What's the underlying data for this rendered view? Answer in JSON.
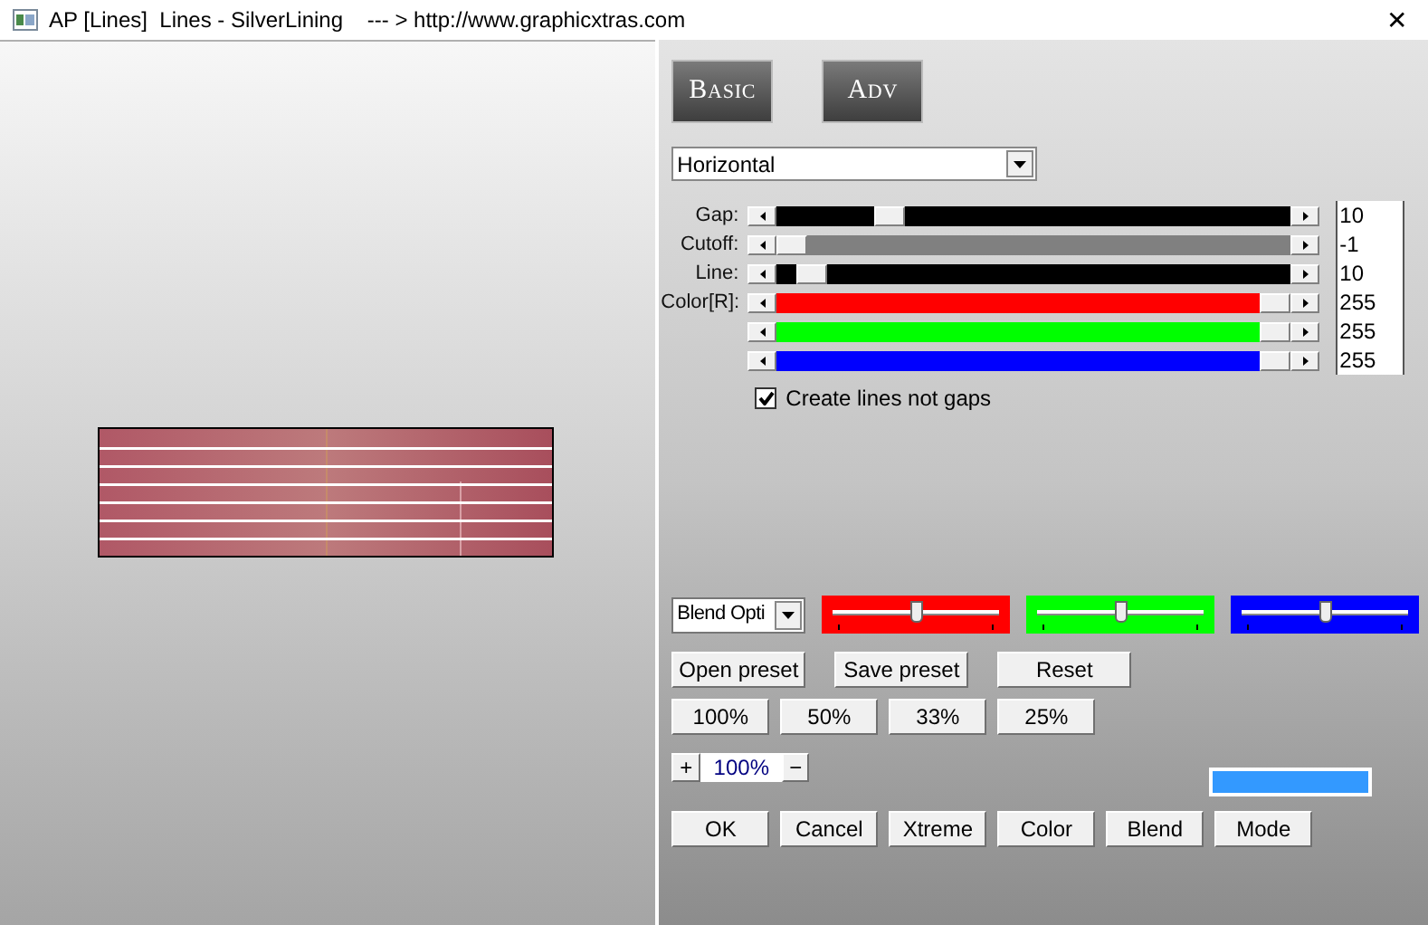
{
  "window": {
    "title": "AP [Lines]  Lines - SilverLining    --- > http://www.graphicxtras.com",
    "close": "✕"
  },
  "mode_buttons": [
    "Basic",
    "Adv"
  ],
  "direction": {
    "value": "Horizontal"
  },
  "sliders": [
    {
      "label": "Gap:",
      "level": 0.2,
      "value": "10",
      "color": "#000000"
    },
    {
      "label": "Cutoff:",
      "level": 0.0,
      "value": "-1",
      "color": "#808080"
    },
    {
      "label": "Line:",
      "level": 0.04,
      "value": "10",
      "color": "#000000"
    },
    {
      "label": "Color[R]:",
      "level": 1.0,
      "value": "255",
      "color": "#ff0000"
    },
    {
      "level": 1.0,
      "value": "255",
      "color": "#00ff00"
    },
    {
      "level": 1.0,
      "value": "255",
      "color": "#0000ff"
    }
  ],
  "create_lines": {
    "label": "Create lines not gaps",
    "checked": true
  },
  "blend": {
    "value": "Blend Opti"
  },
  "channel_sliders": [
    {
      "color": "#ff0000",
      "level": 0.5
    },
    {
      "color": "#00ff00",
      "level": 0.5
    },
    {
      "color": "#0000ff",
      "level": 0.5
    }
  ],
  "preset_buttons": [
    "Open preset",
    "Save preset",
    "Reset"
  ],
  "zoom_buttons": [
    "100%",
    "50%",
    "33%",
    "25%"
  ],
  "zoom": {
    "plus": "+",
    "value": "100%",
    "minus": "−"
  },
  "swatch": {
    "color": "#3399ff"
  },
  "bottom_buttons": [
    "OK",
    "Cancel",
    "Xtreme",
    "Color",
    "Blend",
    "Mode"
  ]
}
